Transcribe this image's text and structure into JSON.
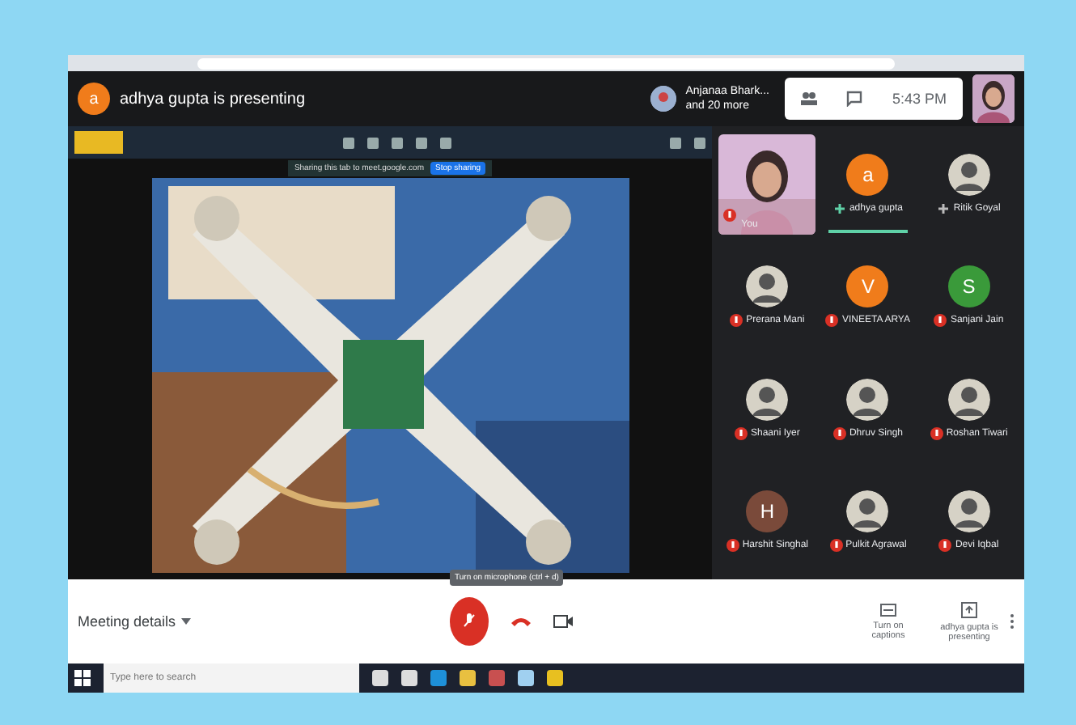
{
  "header": {
    "presenter_initial": "a",
    "title": "adhya gupta is presenting",
    "participant_name": "Anjanaa Bhark...",
    "participant_more": "and 20 more",
    "time": "5:43 PM"
  },
  "share_bar": {
    "message": "Sharing this tab to meet.google.com",
    "button": "Stop sharing"
  },
  "tiles": [
    {
      "kind": "video",
      "name": "You",
      "muted": true,
      "speaking": false
    },
    {
      "kind": "letter",
      "letter": "a",
      "color": "#f07c1b",
      "name": "adhya gupta",
      "muted": false,
      "speaking": true
    },
    {
      "name": "Ritik Goyal",
      "muted": false,
      "speaking": false
    },
    {
      "name": "Prerana Mani",
      "muted": true,
      "speaking": false
    },
    {
      "kind": "letter",
      "letter": "V",
      "color": "#f07c1b",
      "name": "VINEETA ARYA",
      "muted": true,
      "speaking": false
    },
    {
      "kind": "letter",
      "letter": "S",
      "color": "#3a9a3a",
      "name": "Sanjani Jain",
      "muted": true,
      "speaking": false
    },
    {
      "name": "Shaani Iyer",
      "muted": true,
      "speaking": false
    },
    {
      "name": "Dhruv Singh",
      "muted": true,
      "speaking": false
    },
    {
      "name": "Roshan Tiwari",
      "muted": true,
      "speaking": false
    },
    {
      "kind": "letter",
      "letter": "H",
      "color": "#7a4a3a",
      "name": "Harshit Singhal",
      "muted": true,
      "speaking": false
    },
    {
      "name": "Pulkit Agrawal",
      "muted": true,
      "speaking": false
    },
    {
      "name": "Devi Iqbal",
      "muted": true,
      "speaking": false
    }
  ],
  "bottom_bar": {
    "details": "Meeting details",
    "tooltip": "Turn on microphone (ctrl + d)",
    "mic_on": false,
    "captions": "Turn on captions",
    "presenting": "adhya gupta is presenting"
  },
  "taskbar": {
    "search_placeholder": "Type here to search"
  }
}
